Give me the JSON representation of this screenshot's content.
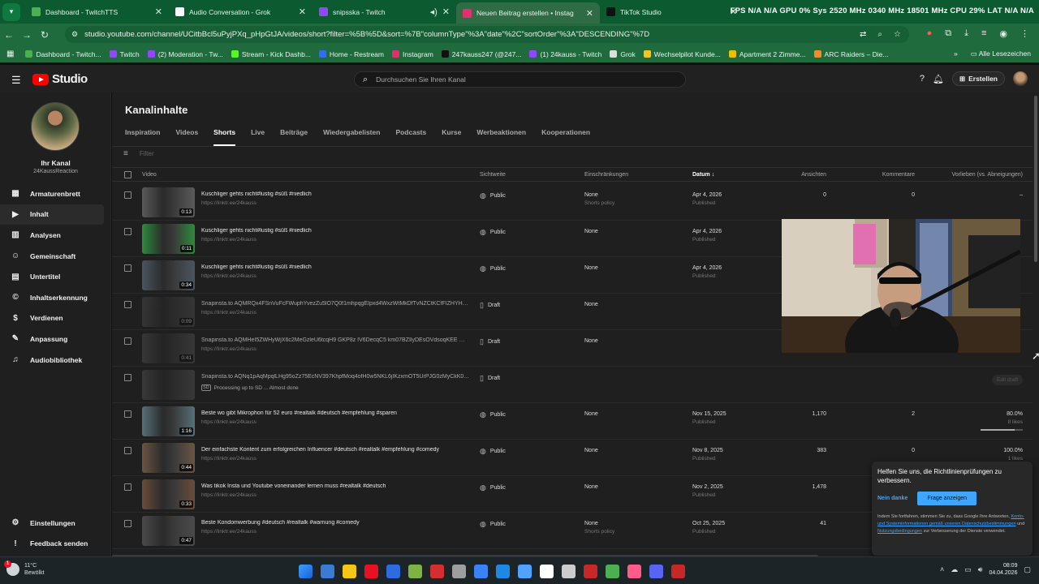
{
  "browser": {
    "tabs": [
      {
        "title": "Dashboard - TwitchTTS",
        "color": "#4caf50"
      },
      {
        "title": "Audio Conversation - Grok",
        "color": "#ffffff"
      },
      {
        "title": "snipsska - Twitch",
        "color": "#9146ff"
      },
      {
        "title": "Neuen Beitrag erstellen • Instag",
        "color": "#e1306c"
      },
      {
        "title": "TikTok Studio",
        "color": "#111111"
      }
    ],
    "sysinfo": "FPS N/A N/A GPU 0% Sys 2520 MHz 0340 MHz 18501 MHz CPU 29% LAT N/A N/A",
    "url": "studio.youtube.com/channel/UCitbBcl5uPyjPXq_pHpGtJA/videos/short?filter=%5B%5D&sort=%7B\"columnType\"%3A\"date\"%2C\"sortOrder\"%3A\"DESCENDING\"%7D",
    "bookmarks": [
      {
        "label": "Dashboard - Twitch...",
        "color": "#4caf50"
      },
      {
        "label": "Twitch",
        "color": "#9146ff"
      },
      {
        "label": "(2) Moderation - Tw...",
        "color": "#9146ff"
      },
      {
        "label": "Stream - Kick Dashb...",
        "color": "#53fc18"
      },
      {
        "label": "Home - Restream",
        "color": "#2f6bff"
      },
      {
        "label": "Instagram",
        "color": "#e1306c"
      },
      {
        "label": "247kauss247 (@247...",
        "color": "#111111"
      },
      {
        "label": "(1) 24kauss - Twitch",
        "color": "#9146ff"
      },
      {
        "label": "Grok",
        "color": "#dddddd"
      },
      {
        "label": "Wechselpilot Kunde...",
        "color": "#f5c518"
      },
      {
        "label": "Apartment 2 Zimme...",
        "color": "#e8c000"
      },
      {
        "label": "ARC Raiders – Die...",
        "color": "#f28c28"
      }
    ],
    "all_bookmarks": "Alle Lesezeichen"
  },
  "studio": {
    "logo": "Studio",
    "search_placeholder": "Durchsuchen Sie Ihren Kanal",
    "create": "Erstellen"
  },
  "sidebar": {
    "title": "Ihr Kanal",
    "name": "24KaussReaction",
    "items": [
      {
        "label": "Armaturenbrett",
        "icon": "▦"
      },
      {
        "label": "Inhalt",
        "icon": "▶"
      },
      {
        "label": "Analysen",
        "icon": "▥"
      },
      {
        "label": "Gemeinschaft",
        "icon": "☺"
      },
      {
        "label": "Untertitel",
        "icon": "▤"
      },
      {
        "label": "Inhaltserkennung",
        "icon": "©"
      },
      {
        "label": "Verdienen",
        "icon": "$"
      },
      {
        "label": "Anpassung",
        "icon": "✎"
      },
      {
        "label": "Audiobibliothek",
        "icon": "♫"
      }
    ],
    "bottom": [
      {
        "label": "Einstellungen",
        "icon": "⚙"
      },
      {
        "label": "Feedback senden",
        "icon": "!"
      }
    ]
  },
  "content": {
    "title": "Kanalinhalte",
    "tabs": [
      "Inspiration",
      "Videos",
      "Shorts",
      "Live",
      "Beiträge",
      "Wiedergabelisten",
      "Podcasts",
      "Kurse",
      "Werbeaktionen",
      "Kooperationen"
    ],
    "filter": "Filter",
    "columns": {
      "video": "Video",
      "visibility": "Sichtweite",
      "restrictions": "Einschränkungen",
      "date": "Datum ↓",
      "views": "Ansichten",
      "comments": "Kommentare",
      "likes": "Vorlieben (vs. Abneigungen)"
    },
    "rows": [
      {
        "title": "Kuschliger gehts nicht#lustig #süß #niedlich",
        "sub": "https://linktr.ee/24kauss",
        "dur": "0:13",
        "vis": "Public",
        "vicon": "◍",
        "restr": "None",
        "restr2": "Shorts policy",
        "date": "Apr 4, 2026",
        "date2": "Published",
        "views": "0",
        "comments": "0",
        "likes": "–",
        "likes2": "",
        "likepct": null,
        "thumb": "#5a5a5a"
      },
      {
        "title": "Kuschliger gehts nicht#lustig #süß #niedlich",
        "sub": "https://linktr.ee/24kauss",
        "dur": "0:11",
        "vis": "Public",
        "vicon": "◍",
        "restr": "None",
        "restr2": "",
        "date": "Apr 4, 2026",
        "date2": "Published",
        "views": "",
        "comments": "",
        "likes": "",
        "likes2": "",
        "likepct": null,
        "thumb": "#2e8b3c"
      },
      {
        "title": "Kuschliger gehts nicht#lustig #süß #niedlich",
        "sub": "https://linktr.ee/24kauss",
        "dur": "0:34",
        "vis": "Public",
        "vicon": "◍",
        "restr": "None",
        "restr2": "",
        "date": "Apr 4, 2026",
        "date2": "Published",
        "views": "",
        "comments": "",
        "likes": "",
        "likes2": "",
        "likepct": null,
        "thumb": "#4a5560"
      },
      {
        "title": "Snapinsta.to AQMRQx4FSnVuFcFWuphYvezZu5lO7Q0f1mhpqgEIpxd4WxzWtMkDfTvNZCtKCfFIZHYHu...",
        "sub": "https://linktr.ee/24kauss",
        "dur": "0:09",
        "vis": "Draft",
        "vicon": "▯",
        "restr": "None",
        "restr2": "",
        "date": "",
        "date2": "",
        "views": "",
        "comments": "",
        "likes": "",
        "likes2": "",
        "likepct": null,
        "thumb": "#505050",
        "draft": true
      },
      {
        "title": "Snapinsta.to AQMHeI5ZWHyWjX6c2MeGzleU6tcqH9 GKP8z IV6DecqC5 km07BZIlyDEsOVdsoqKEE M1...",
        "sub": "https://linktr.ee/24kauss",
        "dur": "0:41",
        "vis": "Draft",
        "vicon": "▯",
        "restr": "None",
        "restr2": "",
        "date": "",
        "date2": "",
        "views": "",
        "comments": "",
        "likes": "",
        "likes2": "",
        "likepct": null,
        "thumb": "#555555",
        "draft": true
      },
      {
        "title": "Snapinsta.to AQNq1pAqMpqlLHg95oZz75EcNV397KhpfMoq4ofH0w5NKL6jIKzxmOT5UrPJG0zMyCkK0...",
        "sub": "Processing up to SD ... Almost done",
        "dur": "",
        "vis": "Draft",
        "vicon": "▯",
        "restr": "",
        "restr2": "",
        "date": "",
        "date2": "",
        "views": "",
        "comments": "",
        "likes": "Edit draft",
        "likes2": "",
        "likepct": null,
        "thumb": "#585858",
        "draft": true,
        "processing": true,
        "badge": "SD"
      },
      {
        "title": "Beste wo gibt Mikrophon für 52 euro #realtalk #deutsch #empfehlung #sparen",
        "sub": "https://linktr.ee/24kauss",
        "dur": "1:16",
        "vis": "Public",
        "vicon": "◍",
        "restr": "None",
        "restr2": "",
        "date": "Nov 15, 2025",
        "date2": "Published",
        "views": "1,170",
        "comments": "2",
        "likes": "80.0%",
        "likes2": "8 likes",
        "likepct": 80,
        "thumb": "#56707a"
      },
      {
        "title": "Der einfachste Kontent zum erfolgreichen Influencer #deutsch #realtalk #empfehlung #comedy",
        "sub": "https://linktr.ee/24kauss",
        "dur": "0:44",
        "vis": "Public",
        "vicon": "◍",
        "restr": "None",
        "restr2": "",
        "date": "Nov 8, 2025",
        "date2": "Published",
        "views": "383",
        "comments": "0",
        "likes": "100.0%",
        "likes2": "1 likes",
        "likepct": 100,
        "thumb": "#6b5543"
      },
      {
        "title": "Was tikok Insta und Youtube voneinander lernen muss #realtalk #deutsch",
        "sub": "https://linktr.ee/24kauss",
        "dur": "0:33",
        "vis": "Public",
        "vicon": "◍",
        "restr": "None",
        "restr2": "",
        "date": "Nov 2, 2025",
        "date2": "Published",
        "views": "1,478",
        "comments": "",
        "likes": "",
        "likes2": "",
        "likepct": null,
        "thumb": "#6a4c3a"
      },
      {
        "title": "Beste Kondomwerbung #deutsch #realtalk #warnung #comedy",
        "sub": "https://linktr.ee/24kauss",
        "dur": "0:47",
        "vis": "Public",
        "vicon": "◍",
        "restr": "None",
        "restr2": "Shorts policy",
        "date": "Oct 25, 2025",
        "date2": "Published",
        "views": "41",
        "comments": "",
        "likes": "",
        "likes2": "",
        "likepct": null,
        "thumb": "#4a4a4a"
      }
    ]
  },
  "survey": {
    "question": "Helfen Sie uns, die Richtlinienprüfungen zu verbessern.",
    "no": "Nein danke",
    "show": "Frage anzeigen",
    "small1": "Indem Sie fortfahren, stimmen Sie zu, dass Google Ihre Antworten,",
    "link1": "Konto- und Systeminformationen gemäß unseren Datenschutzbestimmungen",
    "small2": "und",
    "link2": "Nutzungsbedingungen",
    "small3": "zur Verbesserung der Dienste verwendet."
  },
  "taskbar": {
    "temp": "11°C",
    "cond": "Bewölkt",
    "badge": "1",
    "time": "08:09",
    "date": "04.04.2026",
    "icons": [
      "#1e90ff",
      "#3a7bd5",
      "#f5c518",
      "#e81123",
      "#2d6be0",
      "#7cb342",
      "#d32f2f",
      "#9e9e9e",
      "#3b82f6",
      "#1e88e5",
      "#4fa3ff",
      "#ffffff",
      "#cccccc",
      "#c62828",
      "#4caf50",
      "#ff5c8a",
      "#5865f2",
      "#c62828"
    ]
  }
}
